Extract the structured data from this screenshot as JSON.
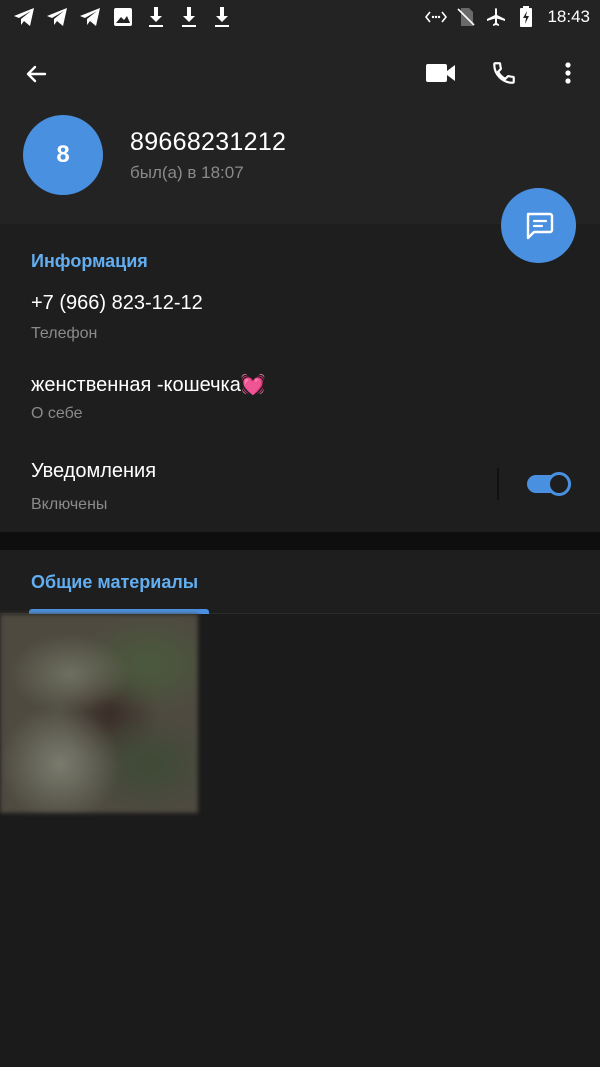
{
  "status_bar": {
    "time": "18:43",
    "left_icons": [
      "telegram-icon",
      "telegram-icon",
      "telegram-icon",
      "image-icon",
      "download-icon",
      "download-icon",
      "download-icon"
    ],
    "right_icons": [
      "data-transfer-icon",
      "no-sim-icon",
      "airplane-icon",
      "battery-charging-icon"
    ]
  },
  "header": {
    "avatar_letter": "8",
    "name": "89668231212",
    "status": "был(а) в 18:07",
    "actions": [
      "back-icon",
      "video-call-icon",
      "phone-icon",
      "more-vert-icon"
    ]
  },
  "info": {
    "title": "Информация",
    "phone_value": "+7 (966) 823-12-12",
    "phone_label": "Телефон",
    "bio_value": "женственная -кошечка💓",
    "bio_label": "О себе",
    "notifications_value": "Уведомления",
    "notifications_label": "Включены",
    "notifications_enabled": true
  },
  "media": {
    "tab_label": "Общие материалы"
  },
  "colors": {
    "accent": "#4a90e0",
    "accent_text": "#63aef0",
    "background": "#1b1b1b"
  }
}
